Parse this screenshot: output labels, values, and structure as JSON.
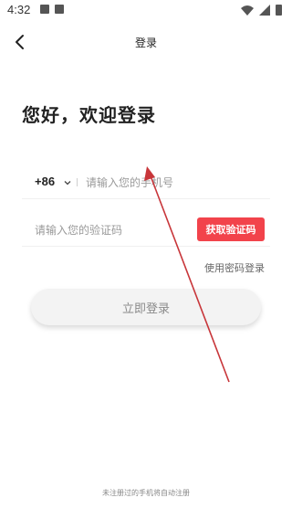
{
  "status_bar": {
    "time": "4:32"
  },
  "header": {
    "title": "登录"
  },
  "welcome": {
    "text": "您好，欢迎登录"
  },
  "phone": {
    "country_code": "+86",
    "placeholder": "请输入您的手机号"
  },
  "verification": {
    "placeholder": "请输入您的验证码",
    "get_code_label": "获取验证码"
  },
  "links": {
    "password_login": "使用密码登录"
  },
  "actions": {
    "login_label": "立即登录"
  },
  "footer": {
    "note": "未注册过的手机将自动注册"
  },
  "colors": {
    "accent": "#f2434b",
    "arrow": "#c8363a"
  },
  "icons": {
    "back": "chevron-left-icon",
    "dropdown": "chevron-down-icon"
  }
}
